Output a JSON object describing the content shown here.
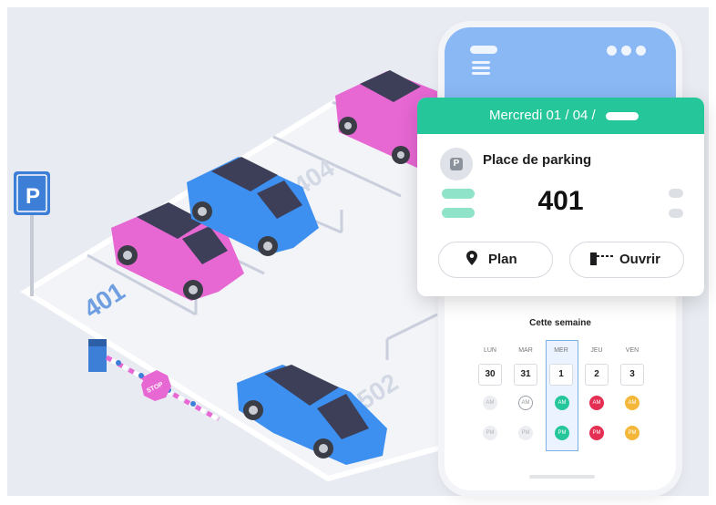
{
  "colors": {
    "accent_green": "#25c79a",
    "phone_header_blue": "#8ab8f5",
    "car_pink": "#e767d3",
    "car_blue": "#3d8ff0",
    "busy_red": "#e42f53",
    "pending_yellow": "#f4b739"
  },
  "scene": {
    "sign_letter": "P",
    "spot_labels": [
      "401",
      "404",
      "502"
    ],
    "stop_sign_text": "STOP"
  },
  "card": {
    "header_text": "Mercredi  01 / 04 /",
    "place_title": "Place de parking",
    "place_icon_letter": "P",
    "place_number": "401",
    "plan_button": "Plan",
    "plan_icon": "location-pin-icon",
    "open_button": "Ouvrir",
    "open_icon": "barrier-gate-icon"
  },
  "calendar": {
    "title": "Cette semaine",
    "days": [
      {
        "name": "LUN",
        "date": "30",
        "am": "AM",
        "pm": "PM",
        "am_state": "past",
        "pm_state": "past"
      },
      {
        "name": "MAR",
        "date": "31",
        "am": "AM",
        "pm": "PM",
        "am_state": "outlined",
        "pm_state": "past"
      },
      {
        "name": "MER",
        "date": "1",
        "am": "AM",
        "pm": "PM",
        "am_state": "booked",
        "pm_state": "booked"
      },
      {
        "name": "JEU",
        "date": "2",
        "am": "AM",
        "pm": "PM",
        "am_state": "busy",
        "pm_state": "busy"
      },
      {
        "name": "VEN",
        "date": "3",
        "am": "AM",
        "pm": "PM",
        "am_state": "pending",
        "pm_state": "pending"
      }
    ],
    "selected_day": "MER"
  }
}
